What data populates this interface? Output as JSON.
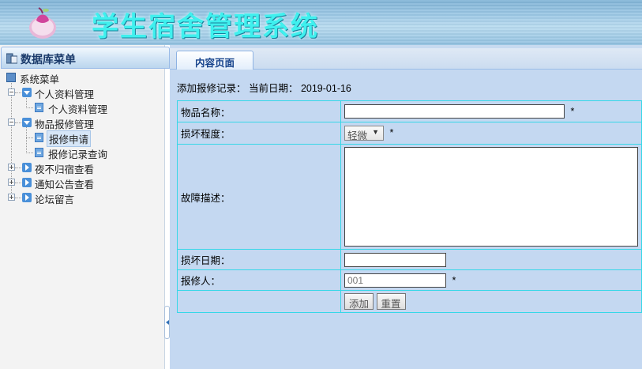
{
  "header": {
    "title": "学生宿舍管理系统",
    "title_color": "#3ff0ee"
  },
  "sidebar": {
    "title": "数据库菜单",
    "items": [
      {
        "label": "系统菜单",
        "icon": "root-icon"
      },
      {
        "label": "个人资料管理",
        "icon": "folder-open-icon",
        "expanded": true
      },
      {
        "label": "个人资料管理",
        "icon": "document-icon"
      },
      {
        "label": "物品报修管理",
        "icon": "folder-open-icon",
        "expanded": true
      },
      {
        "label": "报修申请",
        "icon": "document-icon",
        "selected": true
      },
      {
        "label": "报修记录查询",
        "icon": "document-icon"
      },
      {
        "label": "夜不归宿查看",
        "icon": "folder-closed-icon",
        "expanded": false
      },
      {
        "label": "通知公告查看",
        "icon": "folder-closed-icon",
        "expanded": false
      },
      {
        "label": "论坛留言",
        "icon": "folder-closed-icon",
        "expanded": false
      }
    ]
  },
  "tabs": [
    {
      "label": "内容页面",
      "active": true
    }
  ],
  "page": {
    "heading": "添加报修记录：  当前日期：  2019-01-16"
  },
  "form": {
    "item_name_label": "物品名称：",
    "item_name_value": "",
    "damage_label": "损坏程度：",
    "damage_selected": "轻微",
    "description_label": "故障描述：",
    "description_value": "",
    "damage_date_label": "损坏日期：",
    "damage_date_value": "",
    "reporter_label": "报修人：",
    "reporter_value": "001",
    "required_mark": "*",
    "add_button": "添加",
    "reset_button": "重置"
  },
  "colors": {
    "content_bg": "#c4d8f1",
    "table_border": "#36d7e8",
    "tab_text": "#15428b"
  }
}
